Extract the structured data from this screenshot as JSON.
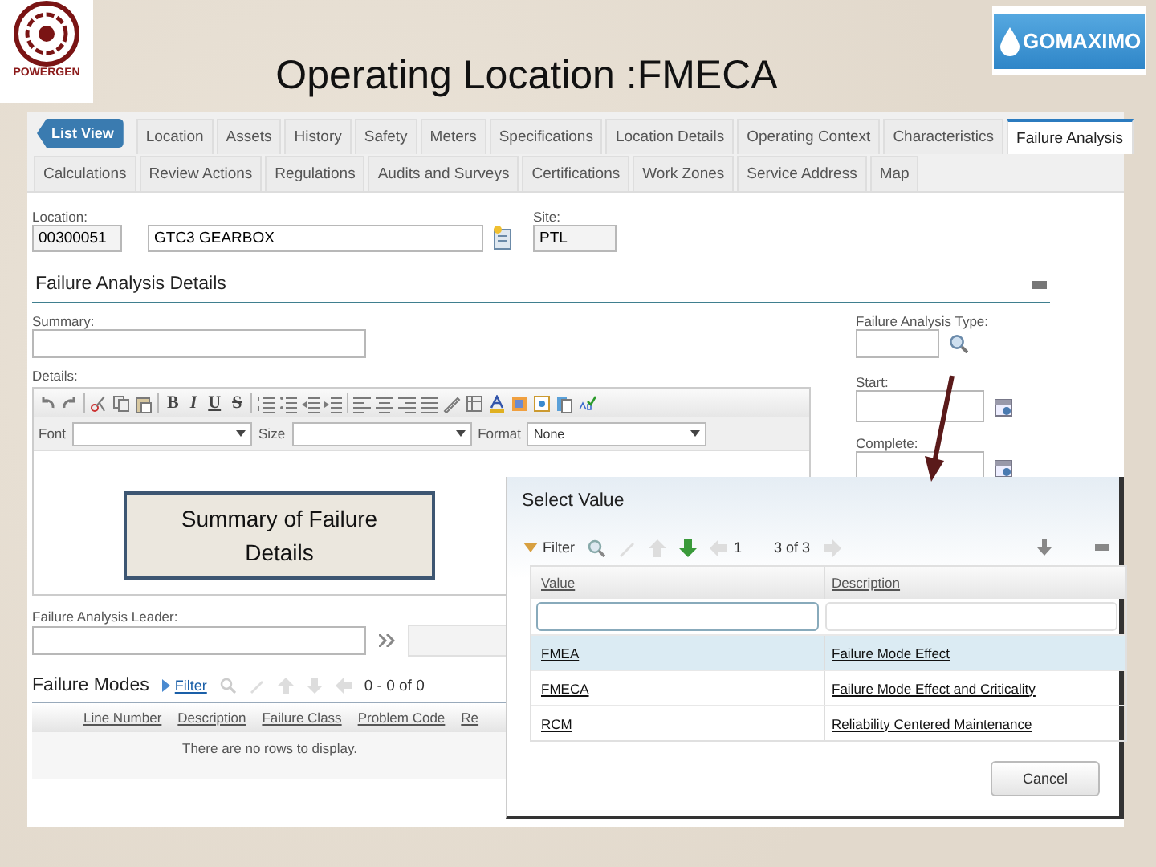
{
  "slide_title": "Operating Location :FMECA",
  "logos": {
    "left": "POWERGEN",
    "right": "GOMAXIMO"
  },
  "list_view_button": "List View",
  "tabs": [
    {
      "label": "Location",
      "selected": false
    },
    {
      "label": "Assets",
      "selected": false
    },
    {
      "label": "History",
      "selected": false
    },
    {
      "label": "Safety",
      "selected": false
    },
    {
      "label": "Meters",
      "selected": false
    },
    {
      "label": "Specifications",
      "selected": false
    },
    {
      "label": "Location Details",
      "selected": false
    },
    {
      "label": "Operating Context",
      "selected": false
    },
    {
      "label": "Characteristics",
      "selected": false
    },
    {
      "label": "Failure Analysis",
      "selected": true
    }
  ],
  "subtabs": [
    {
      "label": "Calculations",
      "selected": false
    },
    {
      "label": "Review Actions",
      "selected": false
    },
    {
      "label": "Regulations",
      "selected": false
    },
    {
      "label": "Audits and Surveys",
      "selected": false
    },
    {
      "label": "Certifications",
      "selected": false
    },
    {
      "label": "Work Zones",
      "selected": false
    },
    {
      "label": "Service Address",
      "selected": false
    },
    {
      "label": "Map",
      "selected": false
    }
  ],
  "location": {
    "label": "Location:",
    "code": "00300051",
    "description": "GTC3 GEARBOX"
  },
  "site": {
    "label": "Site:",
    "value": "PTL"
  },
  "section_title": "Failure Analysis Details",
  "summary": {
    "label": "Summary:"
  },
  "details": {
    "label": "Details:"
  },
  "editor": {
    "format_buttons": [
      "B",
      "I",
      "U",
      "S"
    ],
    "font_label": "Font",
    "size_label": "Size",
    "format_label": "Format",
    "format_value": "None"
  },
  "leader": {
    "label": "Failure Analysis Leader:"
  },
  "analysis_type": {
    "label": "Failure Analysis Type:"
  },
  "start": {
    "label": "Start:"
  },
  "complete": {
    "label": "Complete:"
  },
  "failure_modes": {
    "title": "Failure Modes",
    "filter": "Filter",
    "paging": "0 - 0 of 0",
    "columns": [
      "Line Number",
      "Description",
      "Failure Class",
      "Problem Code",
      "Re"
    ],
    "empty_message": "There are no rows to display."
  },
  "callout": "Summary of Failure Details",
  "dialog": {
    "title": "Select Value",
    "filter": "Filter",
    "page_start": "1",
    "page_range": "3 of 3",
    "columns": [
      "Value",
      "Description"
    ],
    "rows": [
      {
        "value": "FMEA",
        "description": "Failure Mode Effect",
        "selected": true
      },
      {
        "value": "FMECA",
        "description": "Failure Mode Effect and Criticality",
        "selected": false
      },
      {
        "value": "RCM",
        "description": "Reliability Centered Maintenance",
        "selected": false
      }
    ],
    "cancel": "Cancel"
  }
}
